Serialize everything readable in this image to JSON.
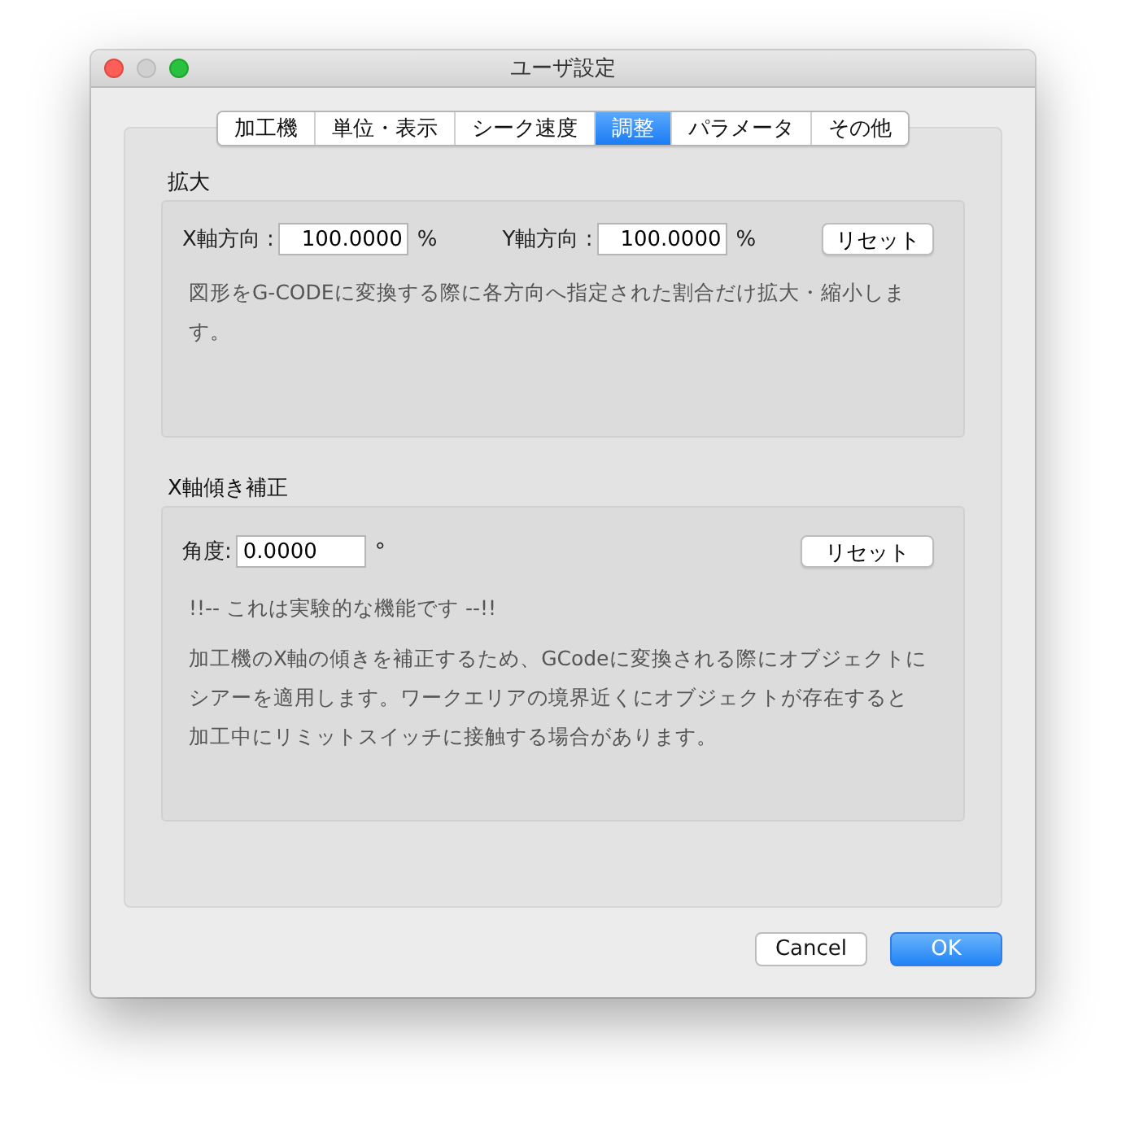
{
  "window": {
    "title": "ユーザ設定"
  },
  "tabs": [
    {
      "label": "加工機",
      "selected": false
    },
    {
      "label": "単位・表示",
      "selected": false
    },
    {
      "label": "シーク速度",
      "selected": false
    },
    {
      "label": "調整",
      "selected": true
    },
    {
      "label": "パラメータ",
      "selected": false
    },
    {
      "label": "その他",
      "selected": false
    }
  ],
  "scale": {
    "title": "拡大",
    "fields": [
      {
        "label": "X軸方向 :",
        "value": "100.0000",
        "unit": "%"
      },
      {
        "label": "Y軸方向 :",
        "value": "100.0000",
        "unit": "%"
      }
    ],
    "reset_button": "リセット",
    "description": "図形をG-CODEに変換する際に各方向へ指定された割合だけ拡大・縮小します。"
  },
  "skew": {
    "title": "X軸傾き補正",
    "fields": [
      {
        "label": "角度:",
        "value": "0.0000",
        "unit": "°"
      }
    ],
    "reset_button": "リセット",
    "warning": "!!-- これは実験的な機能です --!!",
    "description": "加工機のX軸の傾きを補正するため、GCodeに変換される際にオブジェクトにシアーを適用します。ワークエリアの境界近くにオブジェクトが存在すると加工中にリミットスイッチに接触する場合があります。"
  },
  "buttons": [
    {
      "label": "Cancel",
      "kind": "cancel"
    },
    {
      "label": "OK",
      "kind": "default"
    }
  ]
}
